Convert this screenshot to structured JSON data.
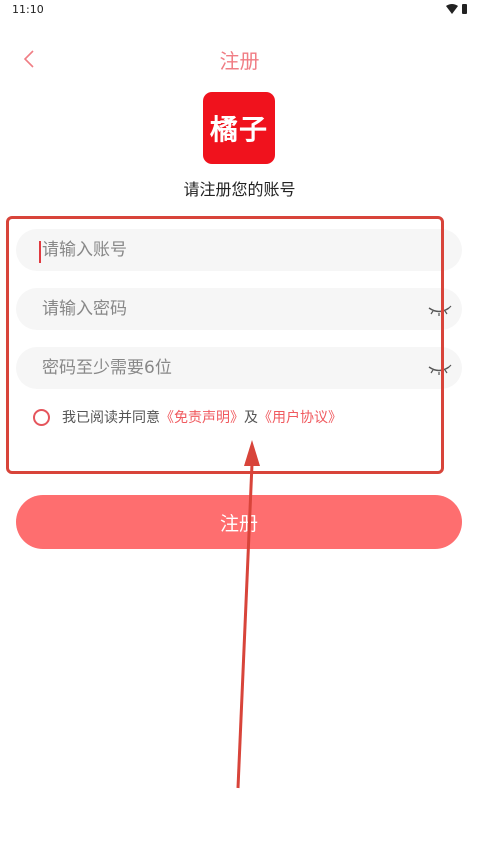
{
  "status_bar": {
    "time": "11:10",
    "icons": [
      "wifi-icon",
      "battery-icon"
    ]
  },
  "header": {
    "back_icon": "chevron-left-icon",
    "title": "注册"
  },
  "logo": {
    "text": "橘子"
  },
  "subtitle": "请注册您的账号",
  "form": {
    "account": {
      "value": "",
      "placeholder": "请输入账号"
    },
    "password": {
      "value": "",
      "placeholder": "请输入密码",
      "toggle_icon": "eye-closed-icon"
    },
    "confirm_password": {
      "value": "",
      "placeholder": "密码至少需要6位",
      "toggle_icon": "eye-closed-icon"
    },
    "agreement": {
      "checked": false,
      "prefix": "我已阅读并同意",
      "disclaimer_link": "《免责声明》",
      "connector": "及",
      "user_agreement_link": "《用户协议》"
    }
  },
  "register_button": {
    "label": "注册"
  },
  "colors": {
    "accent": "#fe6e6f",
    "title": "#f07d84",
    "logo_bg": "#f0121d",
    "link": "#f05a5f",
    "annotation": "#d8443a"
  }
}
